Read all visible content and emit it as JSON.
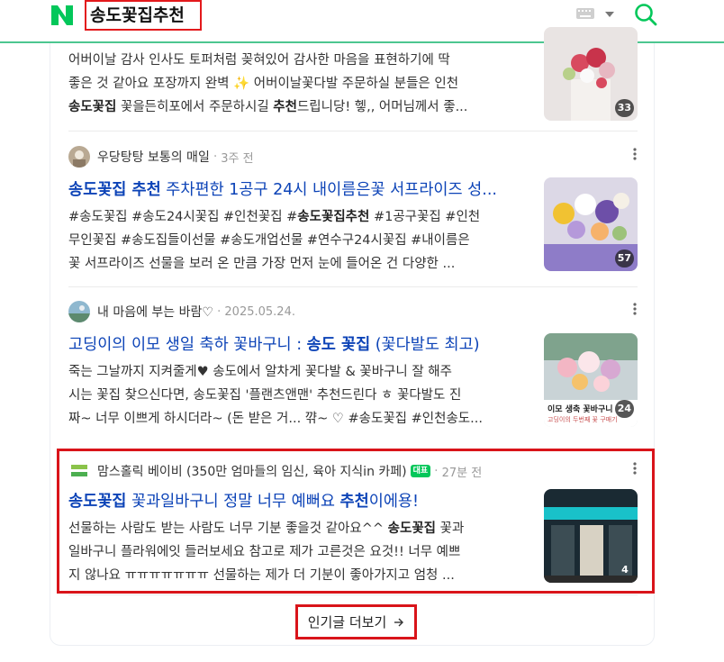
{
  "header": {
    "logo": "N",
    "search_query": "송도꽃집추천",
    "icons": [
      "naver-logo-icon",
      "keyboard-icon",
      "chevron-down-icon",
      "search-icon"
    ],
    "accent_color": "#03c75a"
  },
  "posts": [
    {
      "desc_lines": [
        [
          {
            "t": "어버이날 감사 인사도 토퍼처럼 꽂혀있어 감사한 마음을 표현하기에 딱",
            "b": false
          }
        ],
        [
          {
            "t": "좋은 것 같아요 포장까지 완벽 ✨ 어버이날꽃다발 주문하실 분들은 인천",
            "b": false
          }
        ],
        [
          {
            "t": "송도꽃집",
            "b": true
          },
          {
            "t": " 꽃을든히포에서 주문하시길 ",
            "b": false
          },
          {
            "t": "추천",
            "b": true
          },
          {
            "t": "드립니당! 헿,, 어머님께서 좋...",
            "b": false
          }
        ]
      ],
      "thumb_count": "33"
    },
    {
      "author": "우당탕탕 보통의 매일",
      "date": "3주 전",
      "title": [
        {
          "t": "송도꽃집 추천",
          "b": true
        },
        {
          "t": " 주차편한 1공구 24시 내이름은꽃 서프라이즈 성...",
          "b": false
        }
      ],
      "desc_lines": [
        [
          {
            "t": "#송도꽃집 #송도24시꽃집 #인천꽃집 #",
            "b": false
          },
          {
            "t": "송도꽃집추천",
            "b": true
          },
          {
            "t": " #1공구꽃집 #인천",
            "b": false
          }
        ],
        [
          {
            "t": "무인꽃집 #송도집들이선물 #송도개업선물 #연수구24시꽃집 #내이름은",
            "b": false
          }
        ],
        [
          {
            "t": "꽃 서프라이즈 선물을 보러 온 만큼 가장 먼저 눈에 들어온 건 다양한 ...",
            "b": false
          }
        ]
      ],
      "thumb_count": "57"
    },
    {
      "author": "내 마음에 부는 바람♡",
      "date": "2025.05.24.",
      "title": [
        {
          "t": "고딩이의 이모 생일 축하 꽃바구니 : ",
          "b": false
        },
        {
          "t": "송도 꽃집",
          "b": true
        },
        {
          "t": " (꽃다발도 최고)",
          "b": false
        }
      ],
      "desc_lines": [
        [
          {
            "t": "죽는 그날까지 지켜줄게♥ 송도에서 알차게 꽃다발 & 꽃바구니 잘 해주",
            "b": false
          }
        ],
        [
          {
            "t": "시는 꽃집 찾으신다면, 송도꽃집 '플랜츠앤맨' 추천드린다 ㅎ 꽃다발도 진",
            "b": false
          }
        ],
        [
          {
            "t": "짜~ 너무 이쁘게 하시더라~ (돈 받은 거... 꺆~ ♡ #송도꽃집 #인천송도...",
            "b": false
          }
        ]
      ],
      "thumb_caption": "이모 생축 꽃바구니",
      "thumb_subcaption": "고딩이의 두번째 꽃 구매기",
      "thumb_count": "24"
    },
    {
      "author": "맘스홀릭 베이비 (350만 엄마들의 임신, 육아 지식in 카페)",
      "badge": "대표",
      "date": "27분 전",
      "title": [
        {
          "t": "송도꽃집",
          "b": true
        },
        {
          "t": " 꽃과일바구니 정말 너무 예뻐요 ",
          "b": false
        },
        {
          "t": "추천",
          "b": true
        },
        {
          "t": "이에용!",
          "b": false
        }
      ],
      "desc_lines": [
        [
          {
            "t": "선물하는 사람도 받는 사람도 너무 기분 좋을것 같아요^^ ",
            "b": false
          },
          {
            "t": "송도꽃집",
            "b": true
          },
          {
            "t": " 꽃과",
            "b": false
          }
        ],
        [
          {
            "t": "일바구니 플라워에잇 들러보세요 참고로 제가 고른것은 요것!! 너무 예쁘",
            "b": false
          }
        ],
        [
          {
            "t": "지 않나요 ㅠㅠㅠㅠㅠㅠㅠ 선물하는 제가 더 기분이 좋아가지고 엄청 ...",
            "b": false
          }
        ]
      ],
      "thumb_count": "4"
    }
  ],
  "more_button": {
    "label": "인기글 더보기",
    "icon": "arrow-right-icon"
  }
}
